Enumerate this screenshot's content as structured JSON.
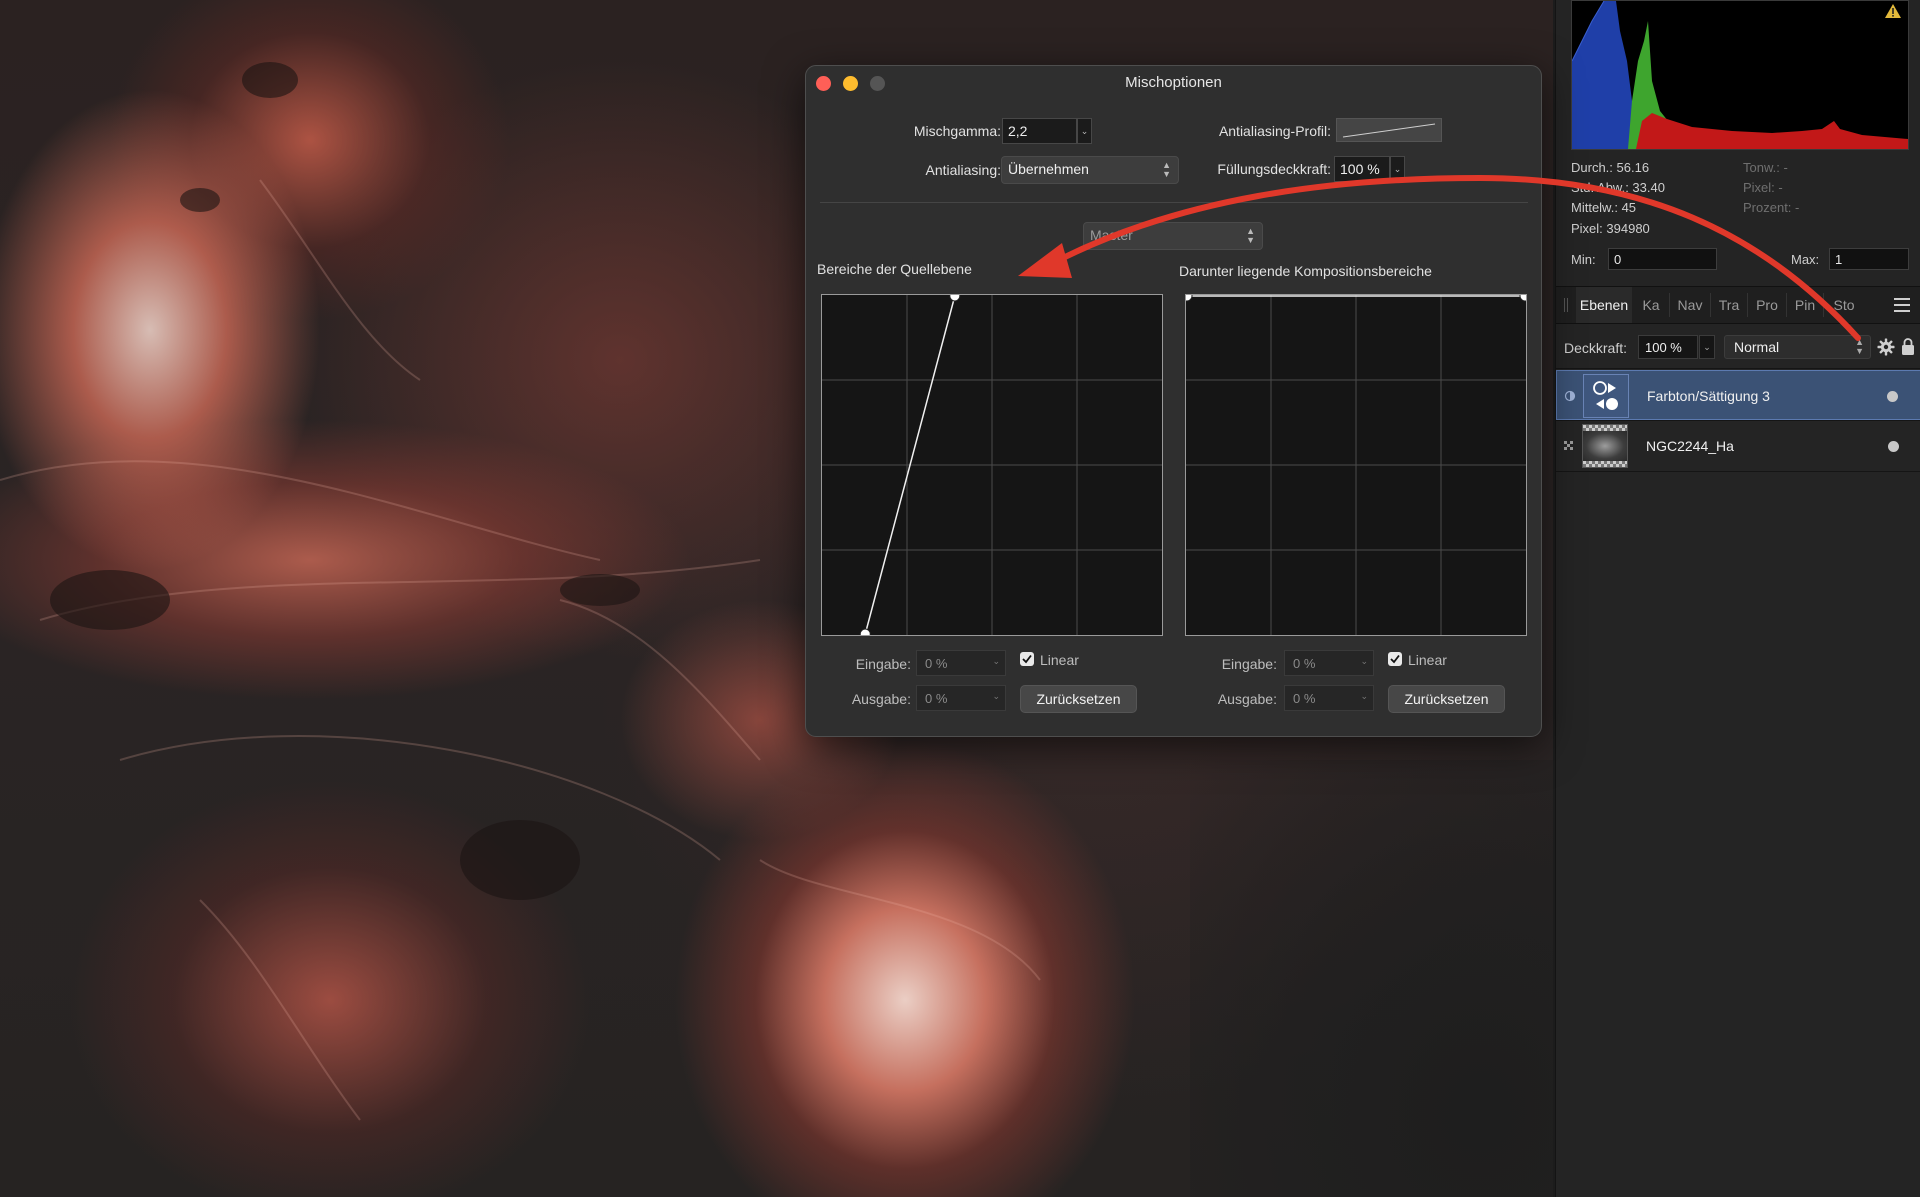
{
  "histogram": {
    "stats_left": [
      "Durch.: 56.16",
      "Std. Abw.: 33.40",
      "Mittelw.: 45",
      "Pixel: 394980"
    ],
    "stats_right": [
      "Tonw.: -",
      "Pixel: -",
      "Prozent: -"
    ],
    "min_label": "Min:",
    "min_value": "0",
    "max_label": "Max:",
    "max_value": "1",
    "colors": {
      "blue": "#1f3fa8",
      "green": "#3ea52e",
      "red": "#c21818"
    }
  },
  "tabs": [
    "Ebenen",
    "Ka",
    "Nav",
    "Tra",
    "Pro",
    "Pin",
    "Sto"
  ],
  "layer_controls": {
    "opacity_label": "Deckkraft:",
    "opacity_value": "100 %",
    "blend_mode": "Normal"
  },
  "layers": [
    {
      "name": "Farbton/Sättigung 3",
      "selected": true
    },
    {
      "name": "NGC2244_Ha",
      "selected": false
    }
  ],
  "dialog": {
    "title": "Mischoptionen",
    "blend_gamma_label": "Mischgamma:",
    "blend_gamma_value": "2,2",
    "antialiasing_profile_label": "Antialiasing-Profil:",
    "antialiasing_label": "Antialiasing:",
    "antialiasing_value": "Übernehmen",
    "fill_opacity_label": "Füllungsdeckkraft:",
    "fill_opacity_value": "100 %",
    "channel": "Master",
    "source_title": "Bereiche der Quellebene",
    "underlying_title": "Darunter liegende Kompositionsbereiche",
    "source_curve": [
      [
        0.125,
        0
      ],
      [
        0.39,
        1
      ]
    ],
    "underlying_curve": [
      [
        0,
        1
      ],
      [
        1,
        1
      ]
    ],
    "input_label": "Eingabe:",
    "output_label": "Ausgabe:",
    "input_value": "0 %",
    "output_value": "0 %",
    "linear_label": "Linear",
    "reset_label": "Zurücksetzen"
  },
  "colors": {
    "accent_arrow": "#e0382a",
    "selection": "#3b5275"
  }
}
